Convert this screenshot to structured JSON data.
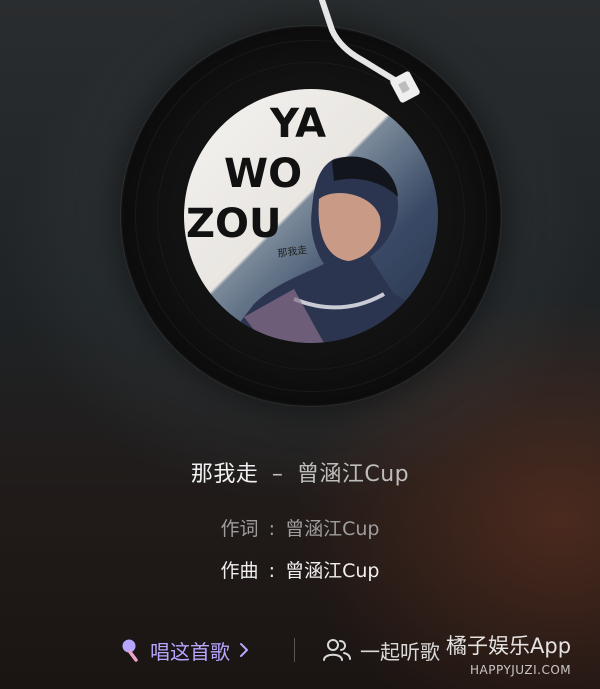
{
  "song": {
    "title": "那我走",
    "dash": "–",
    "artist": "曾涵江Cup"
  },
  "credits": {
    "lyricist_label": "作词",
    "lyricist": "曾涵江Cup",
    "composer_label": "作曲",
    "composer": "曾涵江Cup",
    "separator": ":"
  },
  "cover_art": {
    "text_lines": [
      "YA",
      "WO",
      "ZOU"
    ],
    "side_text": "那我走"
  },
  "actions": {
    "sing_label": "唱这首歌",
    "together_label": "一起听歌"
  },
  "watermark": {
    "brand": "橘子娱乐App",
    "url": "HAPPYJUZI.COM"
  },
  "colors": {
    "accent_purple": "#b7a6ff",
    "text_primary": "#f1f1f1",
    "text_secondary": "#9e9e9e"
  }
}
